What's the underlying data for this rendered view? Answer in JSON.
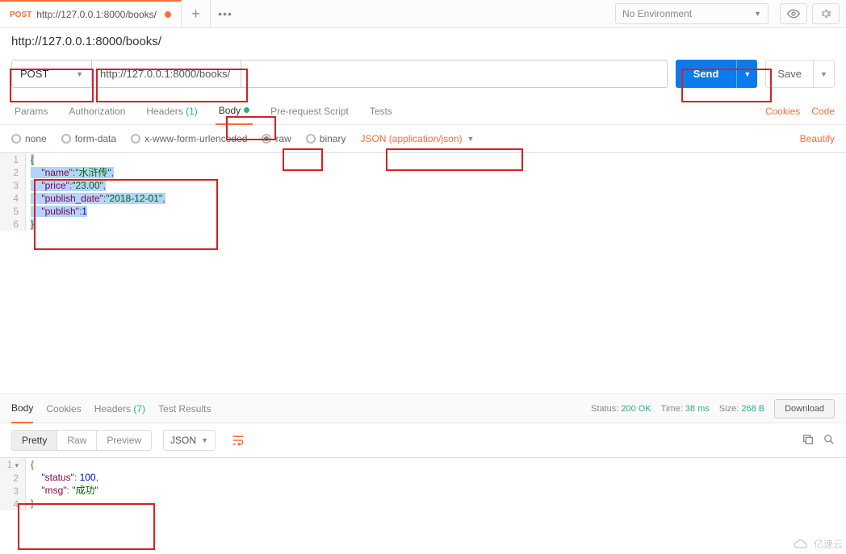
{
  "topbar": {
    "tab_method": "POST",
    "tab_url": "http://127.0.0.1:8000/books/",
    "plus": "+",
    "more": "•••",
    "env_label": "No Environment"
  },
  "url_row": {
    "display": "http://127.0.0.1:8000/books/",
    "method": "POST",
    "url": "http://127.0.0.1:8000/books/",
    "send": "Send",
    "save": "Save"
  },
  "tabs": {
    "params": "Params",
    "authorization": "Authorization",
    "headers": "Headers",
    "headers_count": "(1)",
    "body": "Body",
    "pre": "Pre-request Script",
    "tests": "Tests",
    "cookies": "Cookies",
    "code": "Code"
  },
  "body_types": {
    "none": "none",
    "form_data": "form-data",
    "urlencoded": "x-www-form-urlencoded",
    "raw": "raw",
    "binary": "binary",
    "content_type": "JSON (application/json)",
    "beautify": "Beautify"
  },
  "request_body": {
    "lines": [
      "1",
      "2",
      "3",
      "4",
      "5",
      "6"
    ],
    "l1": "{",
    "l2_key": "\"name\"",
    "l2_val": "\"水浒传\"",
    "l3_key": "\"price\"",
    "l3_val": "\"23.00\"",
    "l4_key": "\"publish_date\"",
    "l4_val": "\"2018-12-01\"",
    "l5_key": "\"publish\"",
    "l5_val": "1",
    "l6": "}"
  },
  "response_tabs": {
    "body": "Body",
    "cookies": "Cookies",
    "headers": "Headers",
    "headers_count": "(7)",
    "test_results": "Test Results"
  },
  "response_status": {
    "status_label": "Status:",
    "status_value": "200 OK",
    "time_label": "Time:",
    "time_value": "38 ms",
    "size_label": "Size:",
    "size_value": "268 B",
    "download": "Download"
  },
  "viewer": {
    "pretty": "Pretty",
    "raw": "Raw",
    "preview": "Preview",
    "lang": "JSON"
  },
  "response_body": {
    "lines": [
      "1",
      "2",
      "3",
      "4"
    ],
    "l1": "{",
    "l2_key": "\"status\"",
    "l2_val": "100",
    "l3_key": "\"msg\"",
    "l3_val": "\"成功\"",
    "l4": "}"
  },
  "watermark": "亿速云"
}
